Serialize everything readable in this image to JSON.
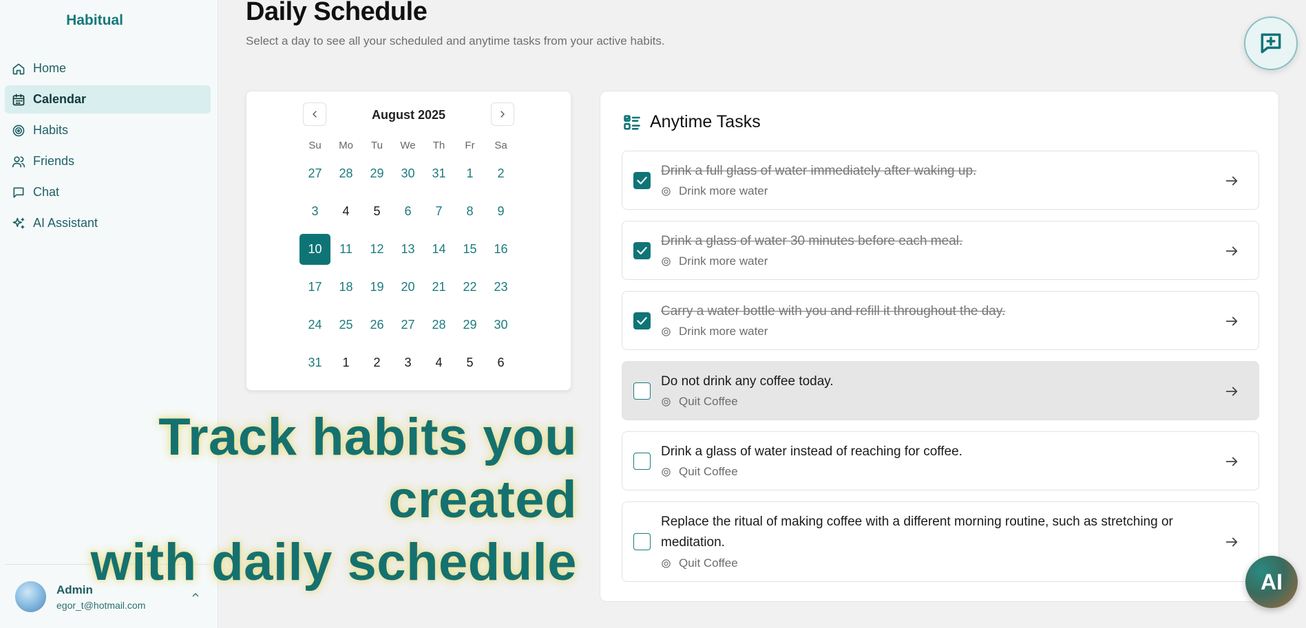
{
  "sidebar": {
    "brand": "Habitual",
    "items": [
      {
        "label": "Home",
        "icon": "home-icon"
      },
      {
        "label": "Calendar",
        "icon": "calendar-icon",
        "active": true
      },
      {
        "label": "Habits",
        "icon": "target-icon"
      },
      {
        "label": "Friends",
        "icon": "users-icon"
      },
      {
        "label": "Chat",
        "icon": "message-icon"
      },
      {
        "label": "AI Assistant",
        "icon": "sparkles-icon"
      }
    ],
    "user": {
      "name": "Admin",
      "email": "egor_t@hotmail.com"
    }
  },
  "header": {
    "title": "Daily Schedule",
    "subtitle": "Select a day to see all your scheduled and anytime tasks from your active habits."
  },
  "calendar": {
    "month": "August 2025",
    "weekdays": [
      "Su",
      "Mo",
      "Tu",
      "We",
      "Th",
      "Fr",
      "Sa"
    ],
    "selected_day": "10",
    "weeks": [
      [
        "27",
        "28",
        "29",
        "30",
        "31",
        "1",
        "2"
      ],
      [
        "3",
        "4",
        "5",
        "6",
        "7",
        "8",
        "9"
      ],
      [
        "10",
        "11",
        "12",
        "13",
        "14",
        "15",
        "16"
      ],
      [
        "17",
        "18",
        "19",
        "20",
        "21",
        "22",
        "23"
      ],
      [
        "24",
        "25",
        "26",
        "27",
        "28",
        "29",
        "30"
      ],
      [
        "31",
        "1",
        "2",
        "3",
        "4",
        "5",
        "6"
      ]
    ]
  },
  "tasks": {
    "title": "Anytime Tasks",
    "items": [
      {
        "title": "Drink a full glass of water immediately after waking up.",
        "habit": "Drink more water",
        "done": true
      },
      {
        "title": "Drink a glass of water 30 minutes before each meal.",
        "habit": "Drink more water",
        "done": true
      },
      {
        "title": "Carry a water bottle with you and refill it throughout the day.",
        "habit": "Drink more water",
        "done": true
      },
      {
        "title": "Do not drink any coffee today.",
        "habit": "Quit Coffee",
        "done": false
      },
      {
        "title": "Drink a glass of water instead of reaching for coffee.",
        "habit": "Quit Coffee",
        "done": false
      },
      {
        "title": "Replace the ritual of making coffee with a different morning routine, such as stretching or meditation.",
        "habit": "Quit Coffee",
        "done": false
      }
    ]
  },
  "promo": {
    "line1": "Track habits you created",
    "line2": "with daily schedule"
  },
  "fab": {
    "ai_label": "AI"
  },
  "colors": {
    "accent": "#0f7476",
    "brand": "#13797a",
    "background": "#f1f1f1"
  }
}
